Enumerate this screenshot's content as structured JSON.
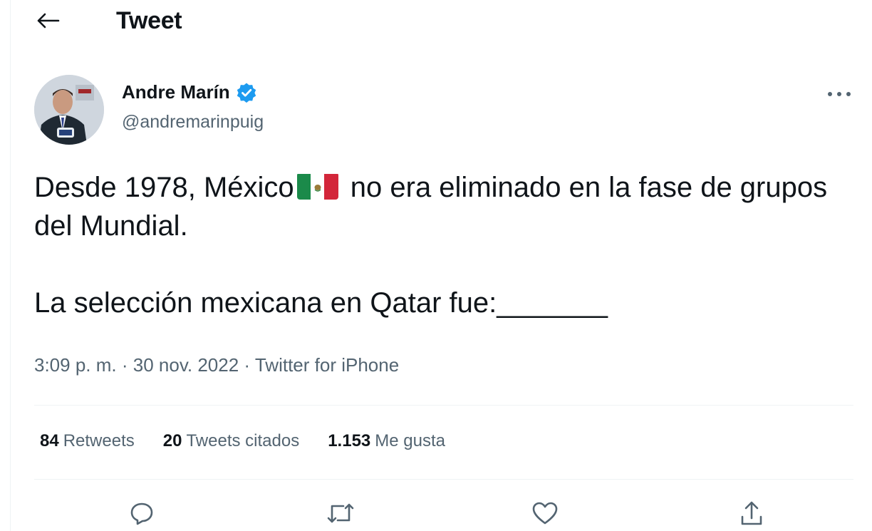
{
  "header": {
    "title": "Tweet"
  },
  "author": {
    "display_name": "Andre Marín",
    "handle": "@andremarinpuig",
    "verified": true
  },
  "tweet": {
    "text_before_flag": "Desde 1978, México",
    "flag_emoji": "mexico-flag",
    "text_after_flag": " no era eliminado en la fase de grupos del Mundial.",
    "paragraph_2": "La selección mexicana en Qatar fue:_______"
  },
  "meta": {
    "time": "3:09 p. m.",
    "separator": "·",
    "date": "30 nov. 2022",
    "source": "Twitter for iPhone"
  },
  "stats": {
    "retweets_count": "84",
    "retweets_label": "Retweets",
    "quotes_count": "20",
    "quotes_label": "Tweets citados",
    "likes_count": "1.153",
    "likes_label": "Me gusta"
  },
  "colors": {
    "text_primary": "#0f1419",
    "text_secondary": "#536471",
    "verified_blue": "#1d9bf0",
    "divider": "#eff3f4"
  }
}
